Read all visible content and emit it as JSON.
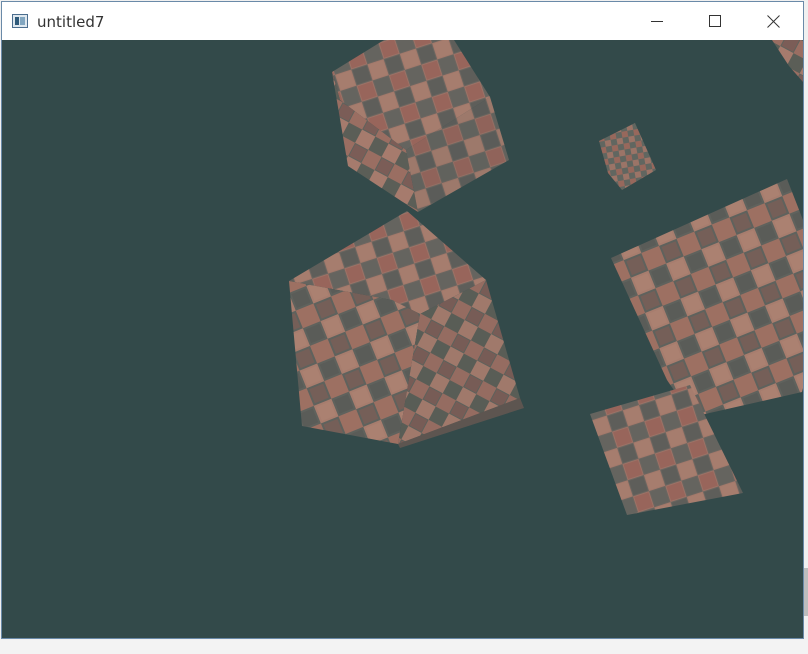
{
  "window": {
    "title": "untitled7",
    "title_icon": "qt-window-icon",
    "controls": [
      "minimize-icon",
      "maximize-icon",
      "close-icon"
    ]
  },
  "scene": {
    "background_color": "#334a4a",
    "tile_color_dark": "#5e605a",
    "tile_color_light": "#a07a6c",
    "tile_color_red": "#9b5550",
    "objects": [
      "cube-top",
      "cube-small",
      "cube-center",
      "cube-right",
      "cube-right-lower",
      "cube-corner-edge"
    ]
  }
}
